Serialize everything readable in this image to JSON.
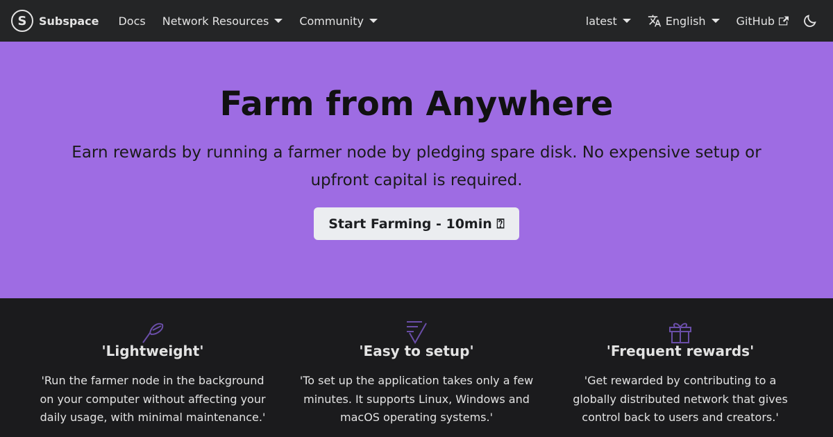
{
  "navbar": {
    "brand_letter": "S",
    "brand_name": "Subspace",
    "docs": "Docs",
    "network_resources": "Network Resources",
    "community": "Community",
    "version": "latest",
    "language": "English",
    "github": "GitHub"
  },
  "hero": {
    "title": "Farm from Anywhere",
    "subtitle": "Earn rewards by running a farmer node by pledging spare disk. No expensive setup or upfront capital is required.",
    "cta_label": "Start Farming - 10min ⍰"
  },
  "features": [
    {
      "icon": "feather-icon",
      "title": "'Lightweight'",
      "text": "'Run the farmer node in the background on your computer without affecting your daily usage, with minimal maintenance.'"
    },
    {
      "icon": "checklist-icon",
      "title": "'Easy to setup'",
      "text": "'To set up the application takes only a few minutes. It supports Linux, Windows and macOS operating systems.'"
    },
    {
      "icon": "gift-icon",
      "title": "'Frequent rewards'",
      "text": "'Get rewarded by contributing to a globally distributed network that gives control back to users and creators.'"
    }
  ],
  "colors": {
    "navbar_bg": "#242526",
    "hero_bg": "#9e6ce3",
    "page_bg": "#1b1b1d",
    "icon_purple": "#6a4ea8"
  }
}
